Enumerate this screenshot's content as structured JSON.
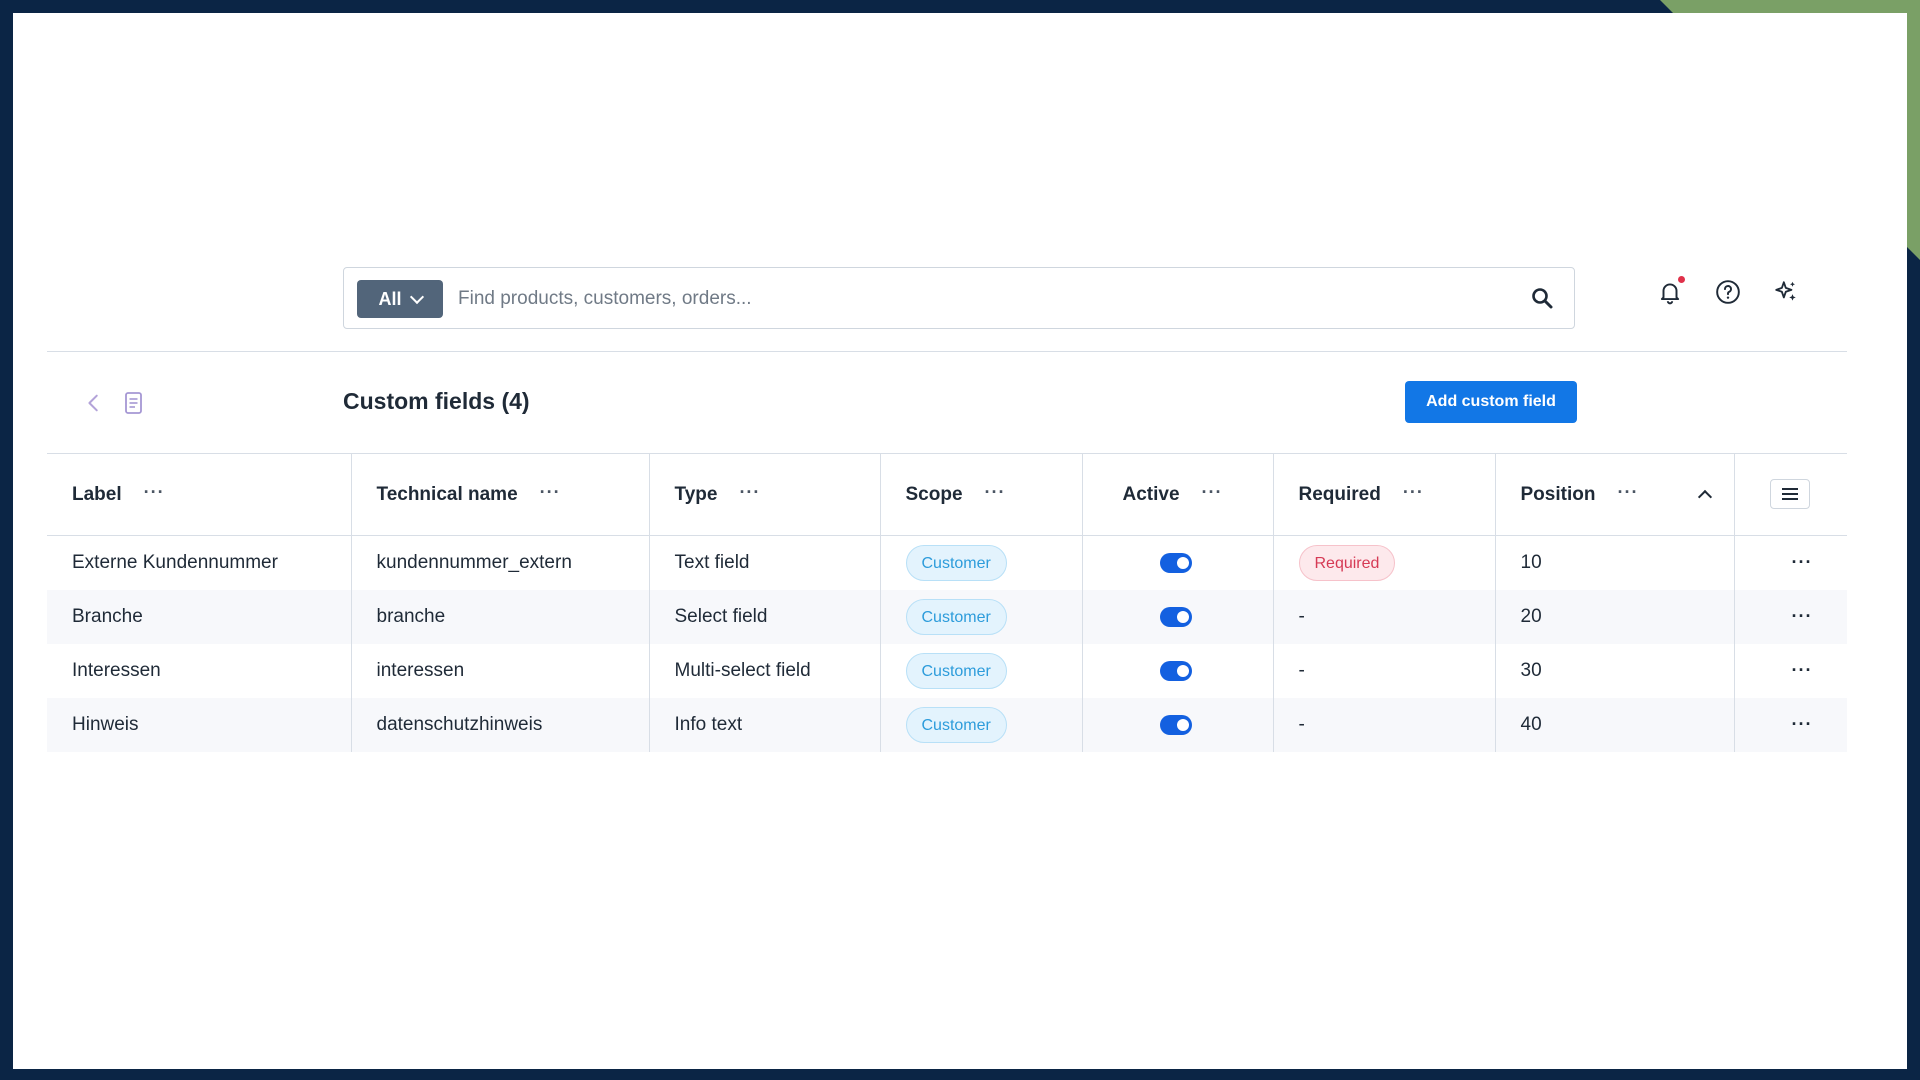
{
  "search": {
    "scope_label": "All",
    "placeholder": "Find products, customers, orders..."
  },
  "icons": [
    "search-icon",
    "bell-icon",
    "help-icon",
    "sparkles-icon",
    "chevron-left-icon",
    "document-icon",
    "columns-menu-icon"
  ],
  "header": {
    "title": "Custom fields (4)",
    "add_button": "Add custom field"
  },
  "table": {
    "columns": {
      "label": "Label",
      "technical_name": "Technical name",
      "type": "Type",
      "scope": "Scope",
      "active": "Active",
      "required": "Required",
      "position": "Position"
    },
    "column_menu_glyph": "···",
    "rows": [
      {
        "label": "Externe Kundennummer",
        "technical_name": "kundennummer_extern",
        "type": "Text field",
        "scope": "Customer",
        "active": true,
        "required": "Required",
        "position": "10"
      },
      {
        "label": "Branche",
        "technical_name": "branche",
        "type": "Select field",
        "scope": "Customer",
        "active": true,
        "required": "-",
        "position": "20"
      },
      {
        "label": "Interessen",
        "technical_name": "interessen",
        "type": "Multi-select field",
        "scope": "Customer",
        "active": true,
        "required": "-",
        "position": "30"
      },
      {
        "label": "Hinweis",
        "technical_name": "datenschutzhinweis",
        "type": "Info text",
        "scope": "Customer",
        "active": true,
        "required": "-",
        "position": "40"
      }
    ]
  },
  "colors": {
    "primary": "#1277e6",
    "toggle_on": "#1360e0",
    "scope_badge": "#2d9cdb",
    "required_badge": "#d63a55",
    "notification_dot": "#e0314a"
  }
}
